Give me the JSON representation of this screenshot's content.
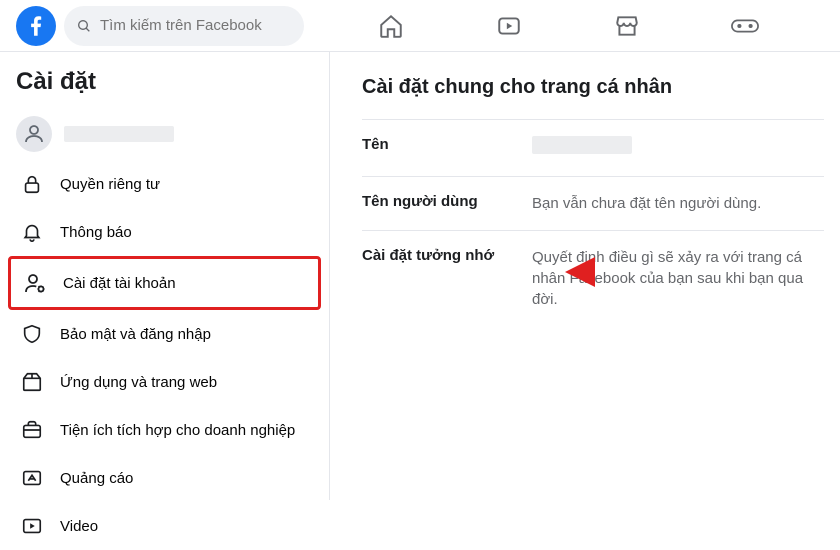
{
  "search": {
    "placeholder": "Tìm kiếm trên Facebook"
  },
  "sidebar": {
    "title": "Cài đặt",
    "items": [
      {
        "label": ""
      },
      {
        "label": "Quyền riêng tư"
      },
      {
        "label": "Thông báo"
      },
      {
        "label": "Cài đặt tài khoản"
      },
      {
        "label": "Bảo mật và đăng nhập"
      },
      {
        "label": "Ứng dụng và trang web"
      },
      {
        "label": "Tiện ích tích hợp cho doanh nghiệp"
      },
      {
        "label": "Quảng cáo"
      },
      {
        "label": "Video"
      }
    ]
  },
  "main": {
    "title": "Cài đặt chung cho trang cá nhân",
    "rows": [
      {
        "key": "Tên",
        "val": ""
      },
      {
        "key": "Tên người dùng",
        "val": "Bạn vẫn chưa đặt tên người dùng."
      },
      {
        "key": "Cài đặt tưởng nhớ",
        "val": "Quyết định điều gì sẽ xảy ra với trang cá nhân Facebook của bạn sau khi bạn qua đời."
      }
    ]
  },
  "colors": {
    "accent": "#1877f2",
    "highlight": "#e02020"
  }
}
